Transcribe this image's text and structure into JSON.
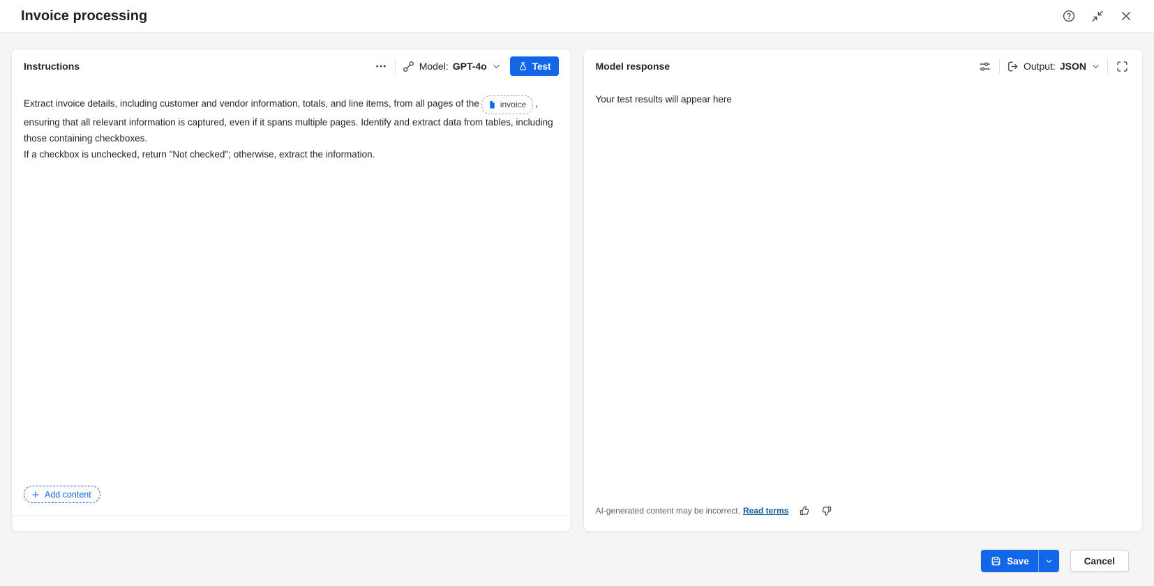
{
  "titlebar": {
    "title": "Invoice processing"
  },
  "instructions_panel": {
    "title": "Instructions",
    "model_label": "Model:",
    "model_value": "GPT-4o",
    "test_button": "Test",
    "prompt": {
      "part1": "Extract invoice details, including customer and vendor information, totals, and line items, from all pages of the",
      "attachment": "invoice",
      "part2": ", ensuring that all relevant information is captured, even if it spans multiple pages. Identify and extract data from tables, including those containing checkboxes.",
      "line2": "If a checkbox is unchecked, return \"Not checked\"; otherwise, extract the information."
    },
    "add_content_button": "Add content"
  },
  "response_panel": {
    "title": "Model response",
    "output_label": "Output:",
    "output_value": "JSON",
    "placeholder": "Your test results will appear here",
    "disclaimer": "AI-generated content may be incorrect.",
    "read_terms_link": "Read terms"
  },
  "footer": {
    "save_button": "Save",
    "cancel_button": "Cancel"
  },
  "colors": {
    "accent_blue": "#1267e8",
    "link_blue": "#115ea3",
    "page_background": "#f5f5f5",
    "panel_background": "#ffffff"
  },
  "icons": {
    "help": "circled question mark",
    "collapse": "inward diagonal arrows",
    "close": "x mark",
    "more_options": "horizontal ellipsis",
    "model": "flow connector",
    "test": "beaker",
    "attachment": "document file",
    "add": "plus",
    "response_options": "sliders",
    "output": "arrow exiting bracket",
    "expand": "fullscreen corners",
    "save": "floppy disk",
    "feedback_positive": "thumbs up",
    "feedback_negative": "thumbs down"
  }
}
